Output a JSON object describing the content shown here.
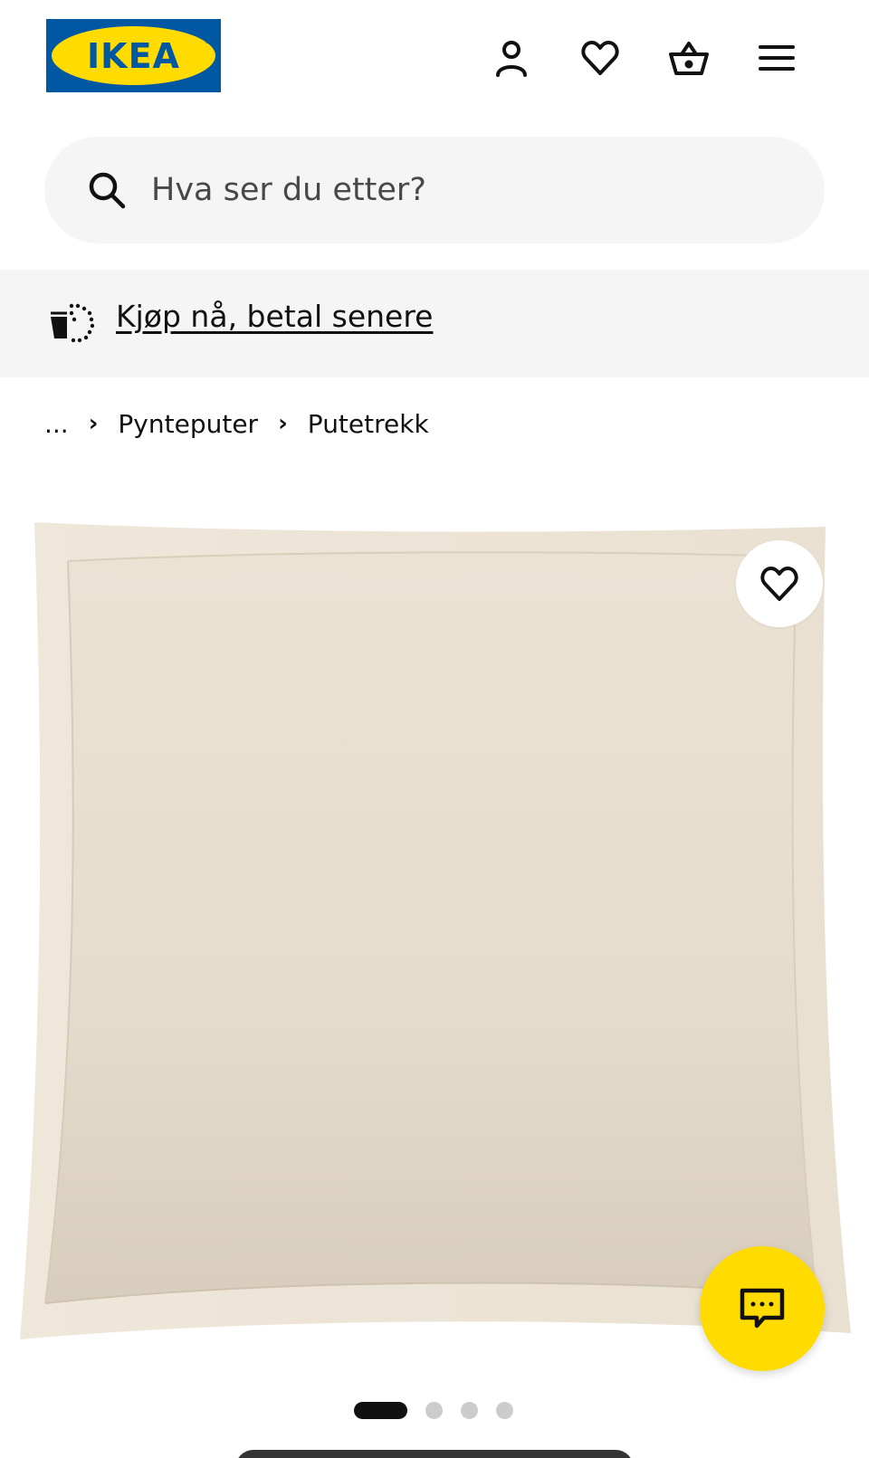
{
  "header": {
    "logo_text": "IKEA",
    "logo_reg": "®",
    "icons": [
      "user-icon",
      "heart-icon",
      "basket-icon",
      "menu-icon"
    ]
  },
  "search": {
    "placeholder": "Hva ser du etter?"
  },
  "banner": {
    "link": "Kjøp nå, betal senere"
  },
  "breadcrumb": {
    "ellipsis": "...",
    "items": [
      "Pynteputer",
      "Putetrekk"
    ]
  },
  "product": {
    "image": "cushion-cover-image",
    "image_count": 4,
    "active_image": 1
  },
  "colors": {
    "brand_blue": "#0058a3",
    "brand_yellow": "#ffdb00",
    "cushion": "#e8ddcc"
  }
}
